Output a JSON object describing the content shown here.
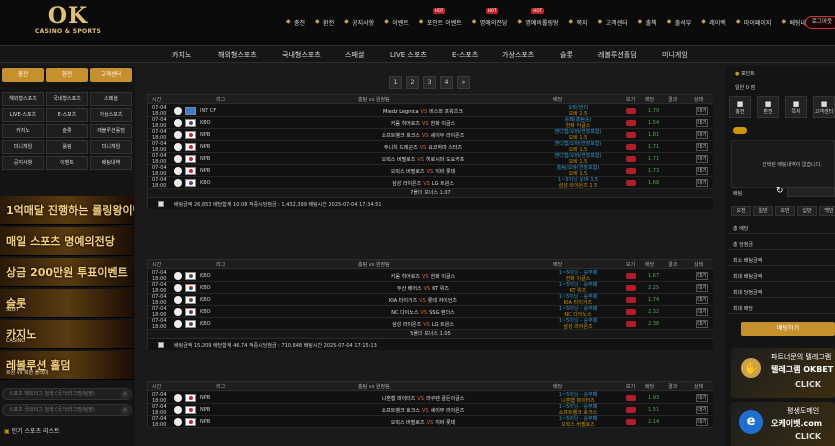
{
  "brand": {
    "logo_big": "OK",
    "logo_small": "CASINO & SPORTS"
  },
  "topnav": [
    {
      "label": "충전",
      "icon": "plus-icon",
      "hot": false
    },
    {
      "label": "환전",
      "icon": "minus-icon",
      "hot": false
    },
    {
      "label": "공지사항",
      "icon": "bullhorn-icon",
      "hot": false
    },
    {
      "label": "이벤트",
      "icon": "gift-icon",
      "hot": false
    },
    {
      "label": "포인트 이벤트",
      "icon": "coin-icon",
      "hot": true
    },
    {
      "label": "명예의전당",
      "icon": "trophy-icon",
      "hot": true
    },
    {
      "label": "명예의롤링왕",
      "icon": "crown-icon",
      "hot": true
    },
    {
      "label": "쪽지",
      "icon": "mail-icon",
      "hot": false
    },
    {
      "label": "고객센터",
      "icon": "headset-icon",
      "hot": false
    },
    {
      "label": "출첵",
      "icon": "calendar-icon",
      "hot": false
    },
    {
      "label": "출석부",
      "icon": "check-icon",
      "hot": false
    },
    {
      "label": "레이백",
      "icon": "refresh-icon",
      "hot": false
    },
    {
      "label": "마이페이지",
      "icon": "user-icon",
      "hot": false
    },
    {
      "label": "베팅내역",
      "icon": "list-icon",
      "hot": false
    }
  ],
  "hot_label": "HOT",
  "logout": "로그아웃",
  "mainnav": [
    "카지노",
    "해외형스포츠",
    "국내형스포츠",
    "스페셜",
    "LIVE 스포츠",
    "E-스포츠",
    "가상스포츠",
    "슬롯",
    "레볼루션홀덤",
    "미니게임"
  ],
  "left": {
    "btns": [
      "충전",
      "환전",
      "고객센터"
    ],
    "grid": [
      "해외형스포츠",
      "국내형스포츠",
      "스페셜",
      "LIVE-스포츠",
      "E-스포츠",
      "가상스포츠",
      "카지노",
      "슬롯",
      "레볼루션홀덤",
      "미니게임",
      "롤링",
      "미니게임",
      "공지사항",
      "이벤트",
      "베팅내역"
    ],
    "banners": [
      {
        "title": "1억매달 진행하는 롤링왕이벤트",
        "sub": ""
      },
      {
        "title": "매일 스포츠 명예의전당",
        "sub": ""
      },
      {
        "title": "상금 200만원 투표이벤트",
        "sub": ""
      },
      {
        "title": "슬롯",
        "sub": "SLOT"
      },
      {
        "title": "카지노",
        "sub": "CASINO"
      },
      {
        "title": "레볼루션 홀덤",
        "sub": "회원 vs 회원 플레이"
      }
    ],
    "search1": "스포츠 해외리그 검색 (국가/리그명/팀명)",
    "search2": "스포츠 국내리그 검색 (국가/리그명/팀명)",
    "popular": "인기 스포츠 리스트"
  },
  "pager": [
    "1",
    "2",
    "3",
    "4",
    "»"
  ],
  "table_headers": [
    "시간",
    "리그",
    "홈팀 vs 원정팀",
    "배당",
    "보기",
    "배당",
    "결과",
    "상태"
  ],
  "sections": [
    {
      "rows": [
        {
          "date": "07-04",
          "time": "18:00",
          "league": "INT CF",
          "home": "Miedz Legnica",
          "away": "비스와 프워츠크",
          "o1": "오바/언더",
          "o2": "오바 2.5",
          "price": "1.70",
          "status": "대기",
          "flag": "int"
        },
        {
          "date": "07-04",
          "time": "18:00",
          "league": "KBO",
          "home": "키움 히어로즈",
          "away": "한화 이글스",
          "o1": "승패(홈팀승)",
          "o2": "한화 이글스",
          "price": "1.54",
          "status": "대기",
          "flag": "kr"
        },
        {
          "date": "07-04",
          "time": "18:00",
          "league": "NPB",
          "home": "소프트뱅크 호크스",
          "away": "세이부 라이온즈",
          "o1": "핸디캡/오바(연장포함)",
          "o2": "오바 1.5",
          "price": "1.81",
          "status": "대기",
          "flag": "jp"
        },
        {
          "date": "07-04",
          "time": "18:00",
          "league": "NPB",
          "home": "주니치 드래곤즈",
          "away": "요코하마 스타즈",
          "o1": "핸디캡/오바(연장포함)",
          "o2": "오바 1.5",
          "price": "1.71",
          "status": "대기",
          "flag": "jp"
        },
        {
          "date": "07-04",
          "time": "18:00",
          "league": "NPB",
          "home": "오릭스 버펄로즈",
          "away": "히로시마 도요카프",
          "o1": "핸디캡/오바(연장포함)",
          "o2": "오바 1.5",
          "price": "1.71",
          "status": "대기",
          "flag": "jp"
        },
        {
          "date": "07-04",
          "time": "18:00",
          "league": "NPB",
          "home": "오릭스 버펄로즈",
          "away": "지바 롯데",
          "o1": "홈팀/오바(연장포함)",
          "o2": "오바 1.5",
          "price": "1.73",
          "status": "대기",
          "flag": "jp"
        },
        {
          "date": "07-04",
          "time": "18:00",
          "league": "KBO",
          "home": "삼성 라이온즈",
          "away": "LG 트윈스",
          "o1": "1~5이닝 오바 3.5",
          "o2": "삼성 라이온즈 1.5",
          "price": "1.68",
          "status": "대기",
          "flag": "kr"
        }
      ],
      "bonus": "7폴더 보너스 1.07",
      "footer": "배팅금액 26,653 배당합계 10.08 적중시당첨금 : 1,432,399 배팅시간 2025-07-04 17:34:51"
    },
    {
      "rows": [
        {
          "date": "07-04",
          "time": "18:00",
          "league": "KBO",
          "home": "키움 히어로즈",
          "away": "한화 이글스",
          "o1": "1~5이닝 - 승무패",
          "o2": "한화 이글스",
          "price": "1.67",
          "status": "대기",
          "flag": "kr"
        },
        {
          "date": "07-04",
          "time": "18:00",
          "league": "KBO",
          "home": "두산 베어스",
          "away": "KT 위즈",
          "o1": "1~5이닝 - 승무패",
          "o2": "KT 위즈",
          "price": "2.25",
          "status": "대기",
          "flag": "kr"
        },
        {
          "date": "07-04",
          "time": "18:00",
          "league": "KBO",
          "home": "KIA 타이거즈",
          "away": "롯데 자이언츠",
          "o1": "1~5이닝 - 승무패",
          "o2": "KIA 타이거즈",
          "price": "1.74",
          "status": "대기",
          "flag": "kr"
        },
        {
          "date": "07-04",
          "time": "18:00",
          "league": "KBO",
          "home": "NC 다이노스",
          "away": "SSG 랜더스",
          "o1": "1~5이닝 - 승무패",
          "o2": "NC 다이노스",
          "price": "2.32",
          "status": "대기",
          "flag": "kr"
        },
        {
          "date": "07-04",
          "time": "18:00",
          "league": "KBO",
          "home": "삼성 라이온즈",
          "away": "LG 트윈스",
          "o1": "1~5이닝 - 승무패",
          "o2": "삼성 라이온즈",
          "price": "2.38",
          "status": "대기",
          "flag": "kr"
        }
      ],
      "bonus": "5폴더 보너스 1.05",
      "footer": "배팅금액 15,209 배당합계 46.74 적중시당첨금 : 710,648 배팅시간 2025-07-04 17:15:13"
    },
    {
      "rows": [
        {
          "date": "07-04",
          "time": "18:00",
          "league": "NPB",
          "home": "니혼햄 파이터즈",
          "away": "라쿠텐 골든이글스",
          "o1": "1~5이닝 - 승무패",
          "o2": "니혼햄 파이터즈",
          "price": "1.93",
          "status": "대기",
          "flag": "jp"
        },
        {
          "date": "07-04",
          "time": "18:00",
          "league": "NPB",
          "home": "소프트뱅크 호크스",
          "away": "세이부 라이온즈",
          "o1": "1~5이닝 - 승무패",
          "o2": "소프트뱅크 호크스",
          "price": "1.51",
          "status": "대기",
          "flag": "jp"
        },
        {
          "date": "07-04",
          "time": "18:00",
          "league": "NPB",
          "home": "오릭스 버펄로즈",
          "away": "지바 롯데",
          "o1": "1~5이닝 - 승무패",
          "o2": "오릭스 버펄로즈",
          "price": "2.14",
          "status": "대기",
          "flag": "jp"
        }
      ]
    }
  ],
  "vs": "VS",
  "right": {
    "point_label": "포인트",
    "point_value": "일반 0 점",
    "icons": [
      "충전",
      "환전",
      "쪽지",
      "고객센터"
    ],
    "empty": "선택된 배팅내역이 없습니다.",
    "bet_label": "배팅",
    "tabs": [
      "오천",
      "일만",
      "오만",
      "십만",
      "백만"
    ],
    "lines": [
      "총 배당",
      "총 당첨금",
      "최소 배팅금액",
      "최대 배팅금액",
      "최대 당첨금액",
      "최대 배당"
    ],
    "bet_button": "배팅하기",
    "ad1": {
      "title": "파트너문의 텔레그램",
      "sub": "텔레그램 OKBET",
      "cta": "CLICK"
    },
    "ad2": {
      "title": "평생도메인",
      "sub": "오케이벳.com",
      "cta": "CLICK"
    }
  }
}
